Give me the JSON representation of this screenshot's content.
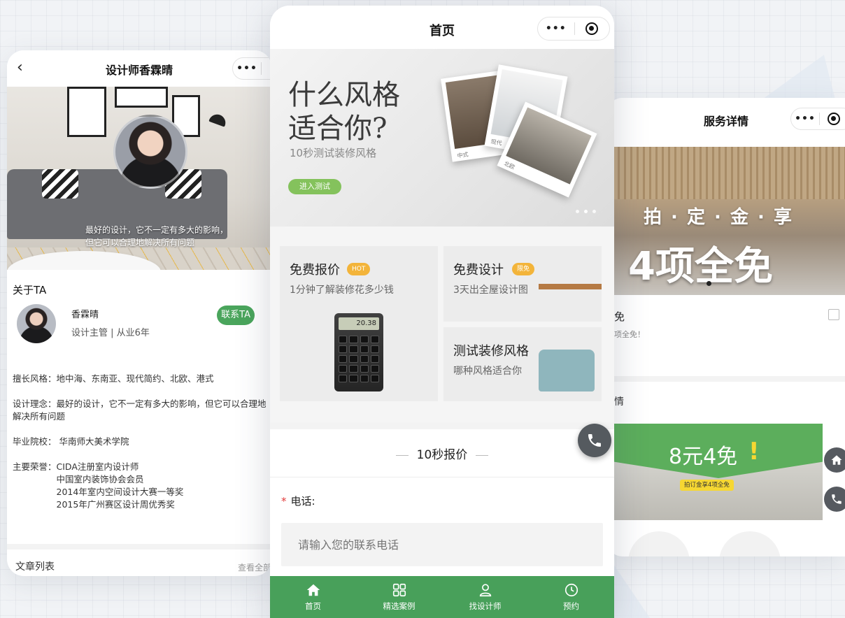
{
  "left_phone": {
    "title": "设计师香霖晴",
    "quote": "最好的设计，它不一定有多大的影响，但它可以合理地解决所有问题",
    "about_heading": "关于TA",
    "designer_name": "香霖晴",
    "designer_role": "设计主管 | 从业6年",
    "contact_label": "联系TA",
    "style_line": "擅长风格：地中海、东南亚、现代简约、北欧、港式",
    "concept_line": "设计理念：最好的设计，它不一定有多大的影响，但它可以合理地解决所有问题",
    "school_line": "毕业院校：  华南师大美术学院",
    "honors_label": "主要荣誉：",
    "honors": [
      "CIDA注册室内设计师",
      "中国室内装饰协会会员",
      "2014年室内空间设计大赛一等奖",
      "2015年广州赛区设计周优秀奖"
    ],
    "article_title": "文章列表",
    "article_more": "查看全部"
  },
  "center_phone": {
    "title": "首页",
    "hero_title_line1": "什么风格",
    "hero_title_line2": "适合你?",
    "hero_subtitle": "10秒测试装修风格",
    "hero_button": "进入测试",
    "photo_caption_1": "中式",
    "photo_caption_2": "现代",
    "photo_caption_3": "北欧",
    "cards": {
      "quote": {
        "title": "免费报价",
        "badge": "HOT",
        "subtitle": "1分钟了解装修花多少钱",
        "calc_display": "20.38"
      },
      "design": {
        "title": "免费设计",
        "badge": "限免",
        "subtitle": "3天出全屋设计图"
      },
      "style": {
        "title": "测试装修风格",
        "subtitle": "哪种风格适合你"
      }
    },
    "quote_section_title": "10秒报价",
    "phone_label": "电话:",
    "phone_required_mark": "*",
    "phone_placeholder": "请输入您的联系电话",
    "tabs": [
      {
        "label": "首页",
        "icon": "home-icon"
      },
      {
        "label": "精选案例",
        "icon": "grid-icon"
      },
      {
        "label": "找设计师",
        "icon": "user-icon"
      },
      {
        "label": "预约",
        "icon": "clock-icon"
      }
    ]
  },
  "right_phone": {
    "title": "服务详情",
    "banner_line1": "拍 · 定 · 金 · 享",
    "banner_line2": "4项全免",
    "service_title": "免",
    "service_sub": "项全免！",
    "detail_heading": "情",
    "promo_big": "8元4免",
    "promo_excl": "!",
    "promo_pill": "拍订金享4项全免"
  },
  "colors": {
    "brand_green": "#48a05a",
    "hot_badge": "#f3b43a",
    "fab_gray": "#555a5f"
  }
}
